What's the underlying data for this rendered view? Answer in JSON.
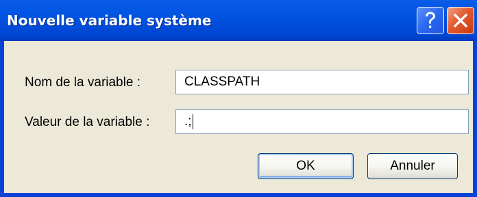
{
  "window": {
    "title": "Nouvelle variable système",
    "help_icon": "question-mark-icon",
    "close_icon": "close-x-icon"
  },
  "form": {
    "name_label": "Nom de la variable :",
    "name_value": "CLASSPATH",
    "value_label": "Valeur de la variable :",
    "value_value": ".;"
  },
  "buttons": {
    "ok_label": "OK",
    "cancel_label": "Annuler"
  },
  "colors": {
    "titlebar": "#0052e0",
    "client": "#ece9d8",
    "close_button": "#e45a2f",
    "help_button": "#2d6af0",
    "field_border": "#7f9db9"
  }
}
